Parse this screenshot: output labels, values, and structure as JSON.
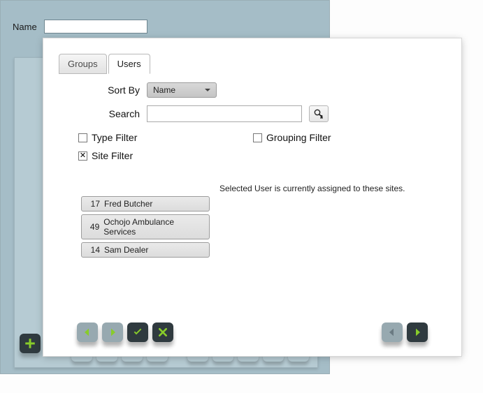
{
  "name_label": "Name",
  "name_value": "",
  "tabs": {
    "groups": "Groups",
    "users": "Users"
  },
  "sort_by": {
    "label": "Sort By",
    "value": "Name"
  },
  "search": {
    "label": "Search",
    "value": ""
  },
  "filters": {
    "type": {
      "label": "Type Filter",
      "checked": false
    },
    "grouping": {
      "label": "Grouping Filter",
      "checked": false
    },
    "site": {
      "label": "Site Filter",
      "checked": true
    }
  },
  "assigned_text": "Selected User is currently assigned to these sites.",
  "users": [
    {
      "id": "17",
      "name": "Fred Butcher"
    },
    {
      "id": "49",
      "name": "Ochojo Ambulance Services"
    },
    {
      "id": "14",
      "name": "Sam Dealer"
    }
  ]
}
